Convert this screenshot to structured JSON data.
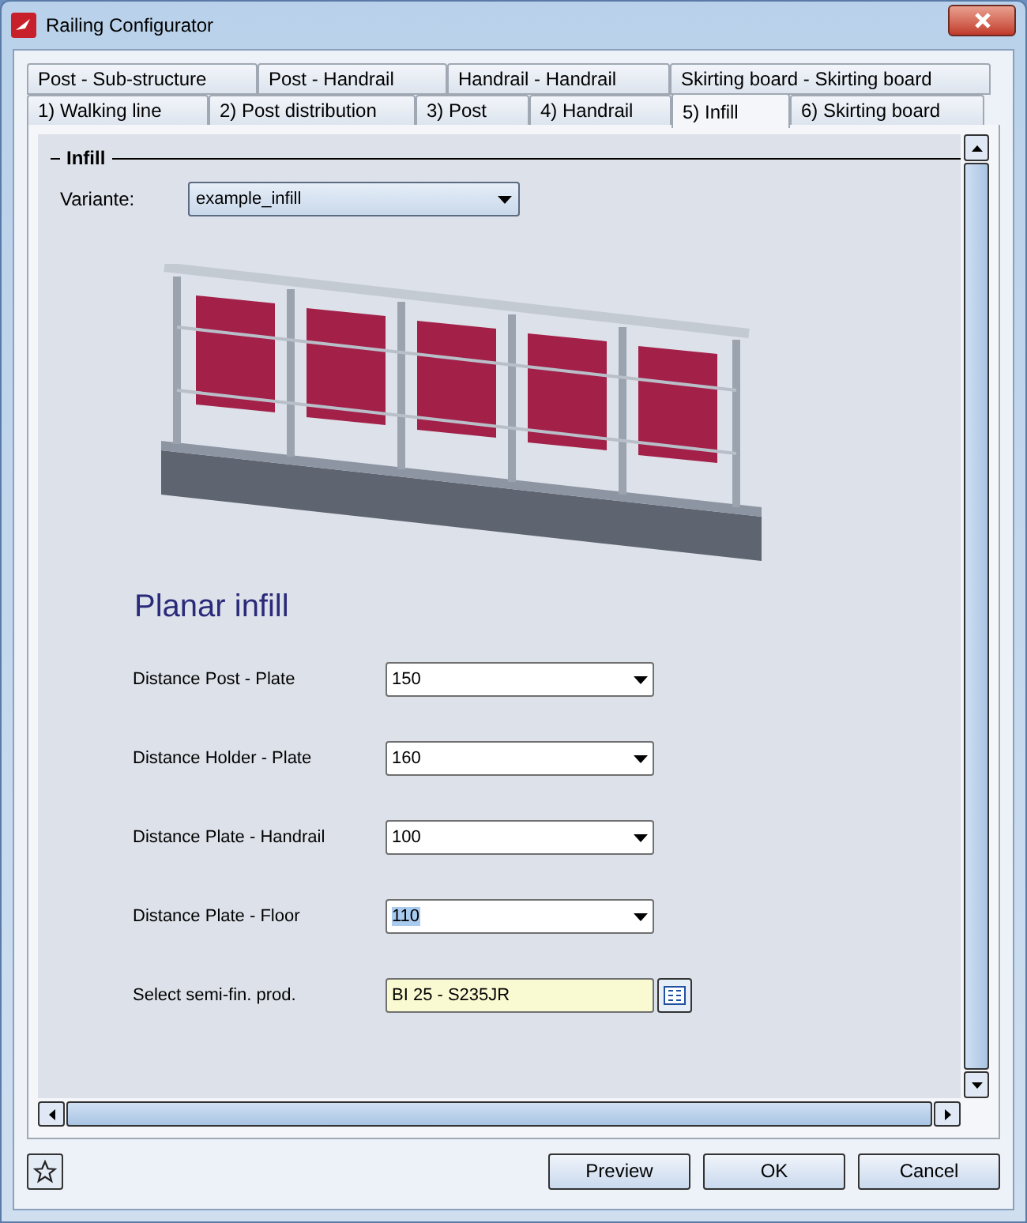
{
  "window": {
    "title": "Railing Configurator"
  },
  "tab_rows": [
    [
      {
        "label": "Post - Sub-structure",
        "selected": false
      },
      {
        "label": "Post - Handrail",
        "selected": false
      },
      {
        "label": "Handrail - Handrail",
        "selected": false
      },
      {
        "label": "Skirting board - Skirting board",
        "selected": false
      }
    ],
    [
      {
        "label": "1) Walking line",
        "selected": false
      },
      {
        "label": "2) Post distribution",
        "selected": false
      },
      {
        "label": "3) Post",
        "selected": false
      },
      {
        "label": "4) Handrail",
        "selected": false
      },
      {
        "label": "5) Infill",
        "selected": true
      },
      {
        "label": "6) Skirting board",
        "selected": false
      }
    ]
  ],
  "group": {
    "title": "Infill",
    "variant_label": "Variante:",
    "variant_value": "example_infill"
  },
  "section_title": "Planar infill",
  "fields": [
    {
      "kind": "dropdown",
      "label": "Distance Post - Plate",
      "value": "150",
      "text_selected": false
    },
    {
      "kind": "dropdown",
      "label": "Distance Holder - Plate",
      "value": "160",
      "text_selected": false
    },
    {
      "kind": "dropdown",
      "label": "Distance Plate - Handrail",
      "value": "100",
      "text_selected": false
    },
    {
      "kind": "dropdown",
      "label": "Distance Plate - Floor",
      "value": "110",
      "text_selected": true
    },
    {
      "kind": "lookup",
      "label": "Select semi-fin. prod.",
      "value": "BI 25 - S235JR",
      "text_selected": false
    }
  ],
  "buttons": [
    "Preview",
    "OK",
    "Cancel"
  ]
}
